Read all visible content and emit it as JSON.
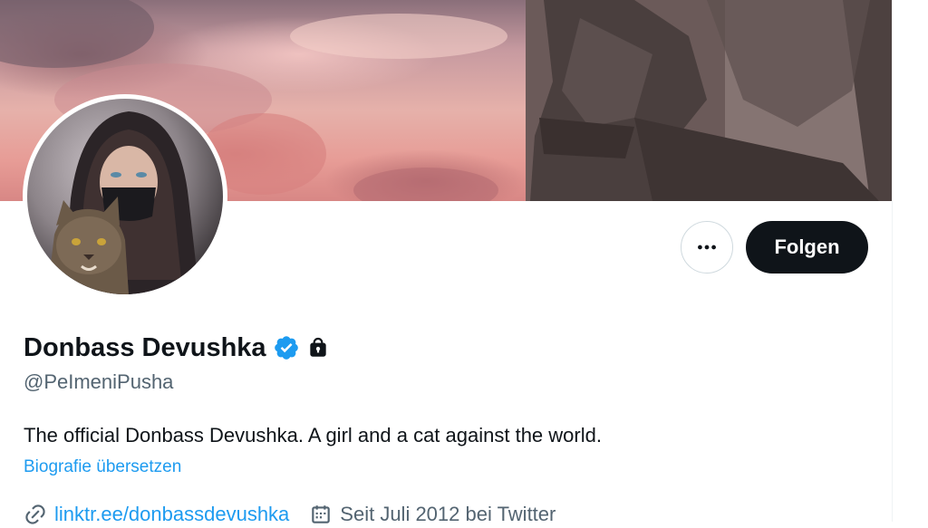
{
  "profile": {
    "display_name": "Donbass Devushka",
    "handle": "@PeImeniPusha",
    "bio": "The official Donbass Devushka. A girl and a cat against the world.",
    "translate_label": "Biografie übersetzen",
    "website": "linktr.ee/donbassdevushka",
    "joined": "Seit Juli 2012 bei Twitter",
    "verified": true,
    "protected": true
  },
  "actions": {
    "more_label": "•••",
    "follow_label": "Folgen"
  },
  "icons": {
    "verified": "verified-badge-icon",
    "lock": "lock-icon",
    "link": "link-icon",
    "calendar": "calendar-icon",
    "more": "more-horizontal-icon"
  },
  "colors": {
    "accent": "#1d9bf0",
    "text_primary": "#0f1419",
    "text_secondary": "#536471",
    "follow_button_bg": "#0f1419",
    "border": "#cfd9de"
  }
}
